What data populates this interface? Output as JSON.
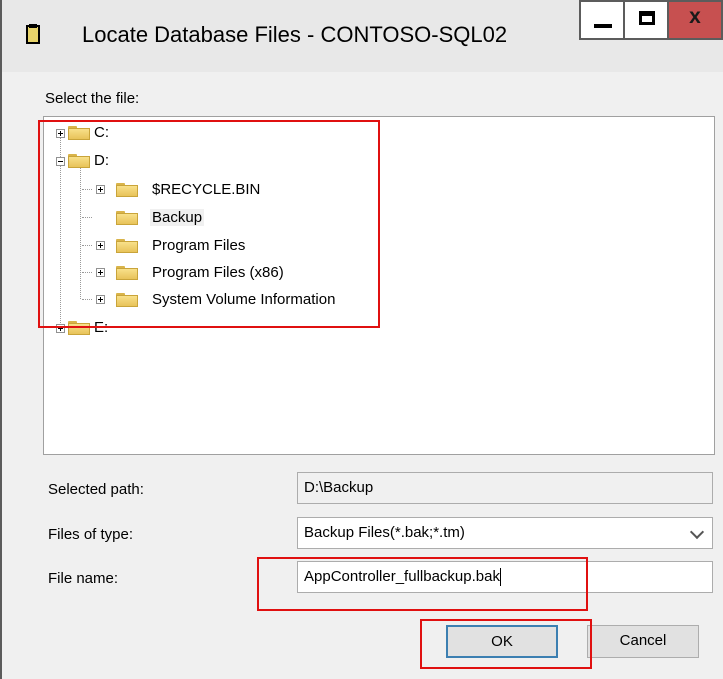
{
  "window": {
    "title": "Locate Database Files - CONTOSO-SQL02"
  },
  "titlebar": {
    "minimize_symbol": "",
    "maximize_symbol": "",
    "close_symbol": "x"
  },
  "labels": {
    "select_file": "Select the file:",
    "selected_path": "Selected path:",
    "files_of_type": "Files of type:",
    "file_name": "File name:"
  },
  "tree": {
    "drive_c": "C:",
    "drive_d": "D:",
    "drive_e": "E:",
    "d_children": [
      "$RECYCLE.BIN",
      "Backup",
      "Program Files",
      "Program Files (x86)",
      "System Volume Information"
    ],
    "selected": "Backup"
  },
  "fields": {
    "selected_path_value": "D:\\Backup",
    "files_of_type_value": "Backup Files(*.bak;*.tm)",
    "file_name_value": "AppController_fullbackup.bak"
  },
  "buttons": {
    "ok": "OK",
    "cancel": "Cancel"
  },
  "colors": {
    "highlight": "#e01010",
    "window_bg": "#f0f0f0",
    "close_button": "#c75050"
  }
}
